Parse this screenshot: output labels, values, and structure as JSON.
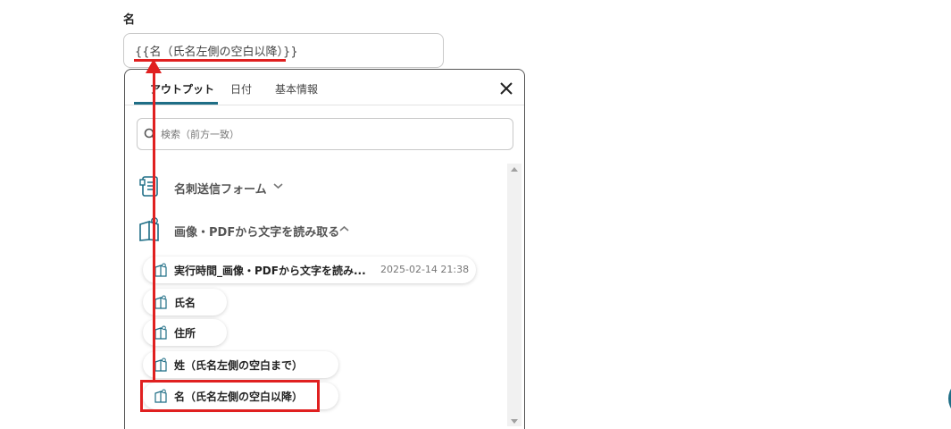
{
  "field": {
    "label": "名",
    "value": "{{名（氏名左側の空白以降）}}"
  },
  "panel": {
    "tabs": [
      {
        "label": "アウトプット",
        "active": true
      },
      {
        "label": "日付",
        "active": false
      },
      {
        "label": "基本情報",
        "active": false
      }
    ],
    "search_placeholder": "検索（前方一致）",
    "sections": [
      {
        "label": "名刺送信フォーム",
        "icon": "form-icon",
        "expanded": false
      },
      {
        "label": "画像・PDFから文字を読み取る",
        "icon": "ocr-icon",
        "expanded": true
      }
    ],
    "items": [
      {
        "label": "実行時間_画像・PDFから文字を読み...",
        "time": "2025-02-14 21:38"
      },
      {
        "label": "氏名"
      },
      {
        "label": "住所"
      },
      {
        "label": "姓（氏名左側の空白まで）"
      },
      {
        "label": "名（氏名左側の空白以降）"
      }
    ]
  },
  "colors": {
    "accent": "#1f6e86",
    "annotation": "#e02020"
  }
}
